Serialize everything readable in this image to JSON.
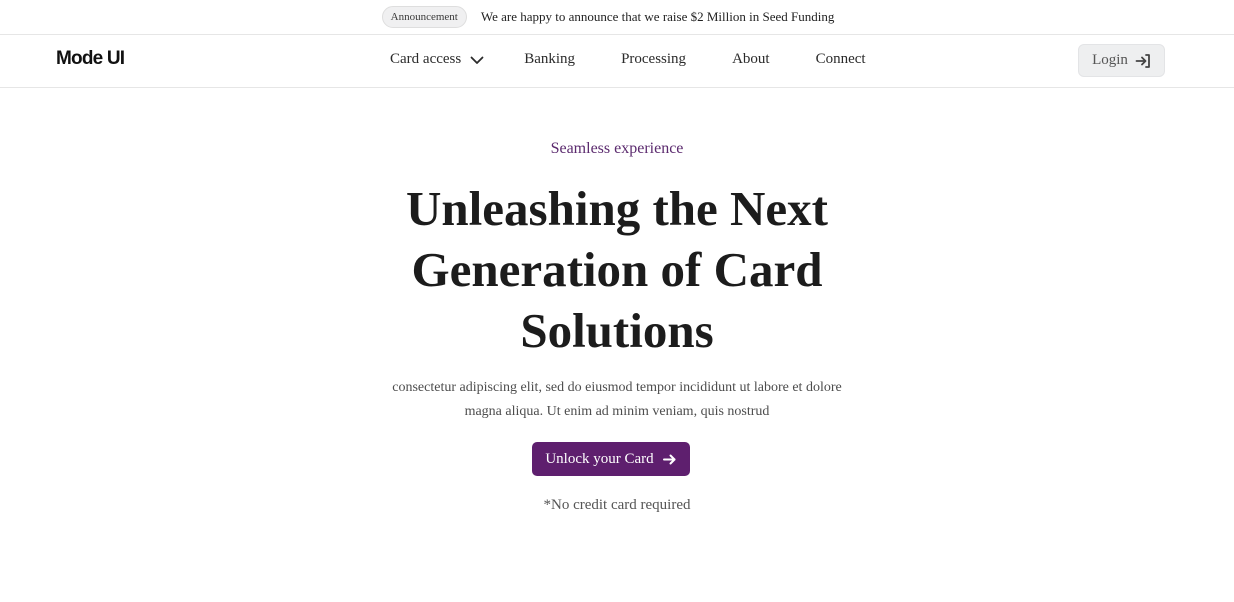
{
  "announcement": {
    "badge": "Announcement",
    "text": "We are happy to announce that we raise $2 Million in Seed Funding"
  },
  "header": {
    "logo": "Mode UI",
    "nav": {
      "card_access": "Card access",
      "banking": "Banking",
      "processing": "Processing",
      "about": "About",
      "connect": "Connect"
    },
    "login_label": "Login"
  },
  "hero": {
    "eyebrow": "Seamless experience",
    "headline": "Unleashing the Next Generation of Card Solutions",
    "subtext": "consectetur adipiscing elit, sed do eiusmod tempor incididunt ut labore et dolore magna aliqua. Ut enim ad minim veniam, quis nostrud",
    "cta_label": "Unlock your Card",
    "disclaimer": "*No credit card required"
  },
  "icons": {
    "dropdown": "chevron-down-icon",
    "login": "login-arrow-icon",
    "cta": "arrow-right-icon"
  },
  "colors": {
    "accent": "#5e1f6e",
    "eyebrow": "#5b2a6e",
    "login_bg": "#eeeff0"
  }
}
